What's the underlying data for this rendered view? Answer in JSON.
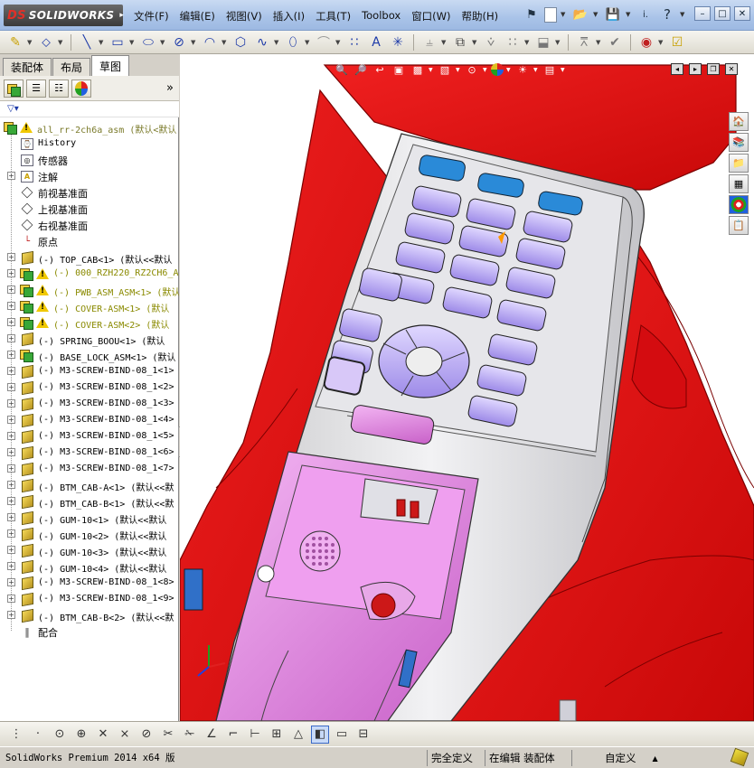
{
  "app": {
    "logo_ds": "DS",
    "logo_name": "SOLIDWORKS"
  },
  "menu": [
    "文件(F)",
    "编辑(E)",
    "视图(V)",
    "插入(I)",
    "工具(T)",
    "Toolbox",
    "窗口(W)",
    "帮助(H)"
  ],
  "quick": {
    "more": "i.",
    "help": "?"
  },
  "panel_tabs": [
    "装配体",
    "布局",
    "草图"
  ],
  "panel_expand": "»",
  "tree": [
    {
      "label": "all_rr-2ch6a_asm  (默认<默认",
      "icon": "asm",
      "warn": true,
      "expander": "-",
      "level": 0,
      "style": "top"
    },
    {
      "label": "History",
      "icon": "history",
      "warn": false,
      "expander": "",
      "level": 1,
      "style": ""
    },
    {
      "label": "传感器",
      "icon": "sensor",
      "warn": false,
      "expander": "",
      "level": 1,
      "style": "cn"
    },
    {
      "label": "注解",
      "icon": "annot",
      "warn": false,
      "expander": "+",
      "level": 1,
      "style": "cn"
    },
    {
      "label": "前视基准面",
      "icon": "plane",
      "warn": false,
      "expander": "",
      "level": 1,
      "style": "cn"
    },
    {
      "label": "上视基准面",
      "icon": "plane",
      "warn": false,
      "expander": "",
      "level": 1,
      "style": "cn"
    },
    {
      "label": "右视基准面",
      "icon": "plane",
      "warn": false,
      "expander": "",
      "level": 1,
      "style": "cn"
    },
    {
      "label": "原点",
      "icon": "origin",
      "warn": false,
      "expander": "",
      "level": 1,
      "style": "cn"
    },
    {
      "label": "(-) TOP_CAB<1> (默认<<默认",
      "icon": "part",
      "warn": false,
      "expander": "+",
      "level": 1,
      "style": ""
    },
    {
      "label": "(-) 000_RZH220_RZ2CH6_A",
      "icon": "asm",
      "warn": true,
      "expander": "+",
      "level": 1,
      "style": "warnc"
    },
    {
      "label": "(-) PWB_ASM_ASM<1> (默认",
      "icon": "asm",
      "warn": true,
      "expander": "+",
      "level": 1,
      "style": "warnc"
    },
    {
      "label": "(-) COVER-ASM<1> (默认",
      "icon": "asm",
      "warn": true,
      "expander": "+",
      "level": 1,
      "style": "warnc"
    },
    {
      "label": "(-) COVER-ASM<2> (默认",
      "icon": "asm",
      "warn": true,
      "expander": "+",
      "level": 1,
      "style": "warnc"
    },
    {
      "label": "(-) SPRING_BOOU<1> (默认",
      "icon": "part",
      "warn": false,
      "expander": "+",
      "level": 1,
      "style": ""
    },
    {
      "label": "(-) BASE_LOCK_ASM<1> (默认",
      "icon": "asm",
      "warn": false,
      "expander": "+",
      "level": 1,
      "style": ""
    },
    {
      "label": "(-) M3-SCREW-BIND-08_1<1>",
      "icon": "part",
      "warn": false,
      "expander": "+",
      "level": 1,
      "style": ""
    },
    {
      "label": "(-) M3-SCREW-BIND-08_1<2>",
      "icon": "part",
      "warn": false,
      "expander": "+",
      "level": 1,
      "style": ""
    },
    {
      "label": "(-) M3-SCREW-BIND-08_1<3>",
      "icon": "part",
      "warn": false,
      "expander": "+",
      "level": 1,
      "style": ""
    },
    {
      "label": "(-) M3-SCREW-BIND-08_1<4>",
      "icon": "part",
      "warn": false,
      "expander": "+",
      "level": 1,
      "style": ""
    },
    {
      "label": "(-) M3-SCREW-BIND-08_1<5>",
      "icon": "part",
      "warn": false,
      "expander": "+",
      "level": 1,
      "style": ""
    },
    {
      "label": "(-) M3-SCREW-BIND-08_1<6>",
      "icon": "part",
      "warn": false,
      "expander": "+",
      "level": 1,
      "style": ""
    },
    {
      "label": "(-) M3-SCREW-BIND-08_1<7>",
      "icon": "part",
      "warn": false,
      "expander": "+",
      "level": 1,
      "style": ""
    },
    {
      "label": "(-) BTM_CAB-A<1> (默认<<默",
      "icon": "part",
      "warn": false,
      "expander": "+",
      "level": 1,
      "style": ""
    },
    {
      "label": "(-) BTM_CAB-B<1> (默认<<默",
      "icon": "part",
      "warn": false,
      "expander": "+",
      "level": 1,
      "style": ""
    },
    {
      "label": "(-) GUM-10<1> (默认<<默认",
      "icon": "part",
      "warn": false,
      "expander": "+",
      "level": 1,
      "style": ""
    },
    {
      "label": "(-) GUM-10<2> (默认<<默认",
      "icon": "part",
      "warn": false,
      "expander": "+",
      "level": 1,
      "style": ""
    },
    {
      "label": "(-) GUM-10<3> (默认<<默认",
      "icon": "part",
      "warn": false,
      "expander": "+",
      "level": 1,
      "style": ""
    },
    {
      "label": "(-) GUM-10<4> (默认<<默认",
      "icon": "part",
      "warn": false,
      "expander": "+",
      "level": 1,
      "style": ""
    },
    {
      "label": "(-) M3-SCREW-BIND-08_1<8>",
      "icon": "part",
      "warn": false,
      "expander": "+",
      "level": 1,
      "style": ""
    },
    {
      "label": "(-) M3-SCREW-BIND-08_1<9>",
      "icon": "part",
      "warn": false,
      "expander": "+",
      "level": 1,
      "style": ""
    },
    {
      "label": "(-) BTM_CAB-B<2> (默认<<默",
      "icon": "part",
      "warn": false,
      "expander": "+",
      "level": 1,
      "style": ""
    },
    {
      "label": "配合",
      "icon": "mate",
      "warn": false,
      "expander": "",
      "level": 1,
      "style": "cn"
    }
  ],
  "status": {
    "app_version": "SolidWorks Premium 2014 x64 版",
    "defined": "完全定义",
    "editing": "在编辑 装配体",
    "custom": "自定义",
    "custom_arrow": "▲"
  },
  "colors": {
    "model_red": "#e8161a",
    "model_dark_red": "#b00808",
    "keypad_gray": "#dcdcde",
    "key_lavender": "#b7a8f0",
    "cavity_magenta": "#e78ce8",
    "accent_blue": "#2080d0"
  }
}
